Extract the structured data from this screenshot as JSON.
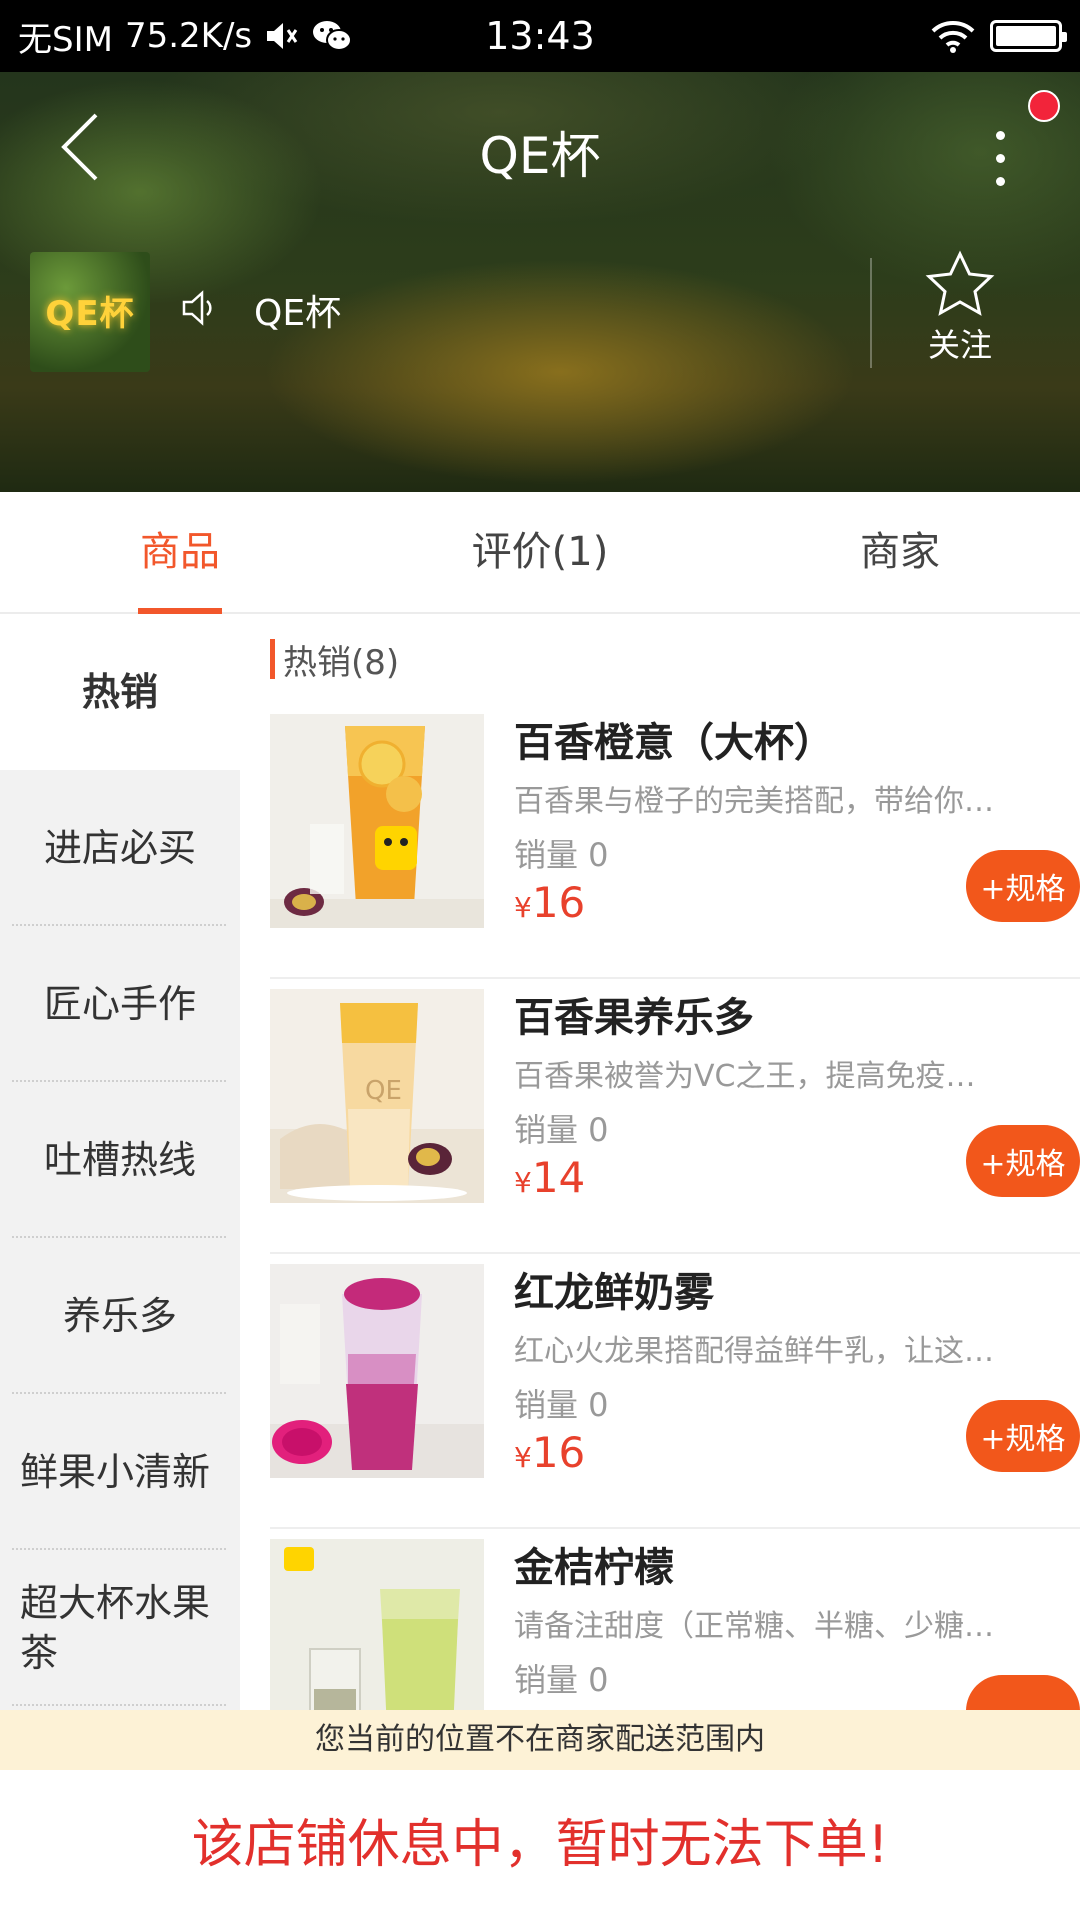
{
  "status_bar": {
    "carrier": "无SIM",
    "speed": "75.2K/s",
    "time": "13:43"
  },
  "header": {
    "title": "QE杯",
    "shop_logo_text": "QE杯",
    "shop_name": "QE杯",
    "follow_label": "关注"
  },
  "tabs": [
    {
      "label": "商品",
      "active": true
    },
    {
      "label": "评价(1)",
      "active": false
    },
    {
      "label": "商家",
      "active": false
    }
  ],
  "categories": [
    {
      "label": "热销",
      "active": true
    },
    {
      "label": "进店必买"
    },
    {
      "label": "匠心手作"
    },
    {
      "label": "吐槽热线"
    },
    {
      "label": "养乐多"
    },
    {
      "label": "鲜果小清新"
    },
    {
      "label": "超大杯水果茶"
    }
  ],
  "section": {
    "title": "热销(8)"
  },
  "products": [
    {
      "name": "百香橙意（大杯）",
      "desc": "百香果与橙子的完美搭配，带给你…",
      "sales": "销量 0",
      "currency": "¥",
      "price": "16",
      "button": "+规格"
    },
    {
      "name": "百香果养乐多",
      "desc": "百香果被誉为VC之王，提高免疫…",
      "sales": "销量 0",
      "currency": "¥",
      "price": "14",
      "button": "+规格"
    },
    {
      "name": "红龙鲜奶雾",
      "desc": "红心火龙果搭配得益鲜牛乳，让这…",
      "sales": "销量 0",
      "currency": "¥",
      "price": "16",
      "button": "+规格"
    },
    {
      "name": "金桔柠檬",
      "desc": "请备注甜度（正常糖、半糖、少糖…",
      "sales": "销量 0",
      "currency": "¥",
      "price": "",
      "button": ""
    }
  ],
  "notice": "您当前的位置不在商家配送范围内",
  "closed_message": "该店铺休息中，暂时无法下单!",
  "colors": {
    "accent": "#f2572b",
    "price": "#e8412c",
    "closed_text": "#e2302c",
    "notice_bg": "#fdf2d6"
  }
}
